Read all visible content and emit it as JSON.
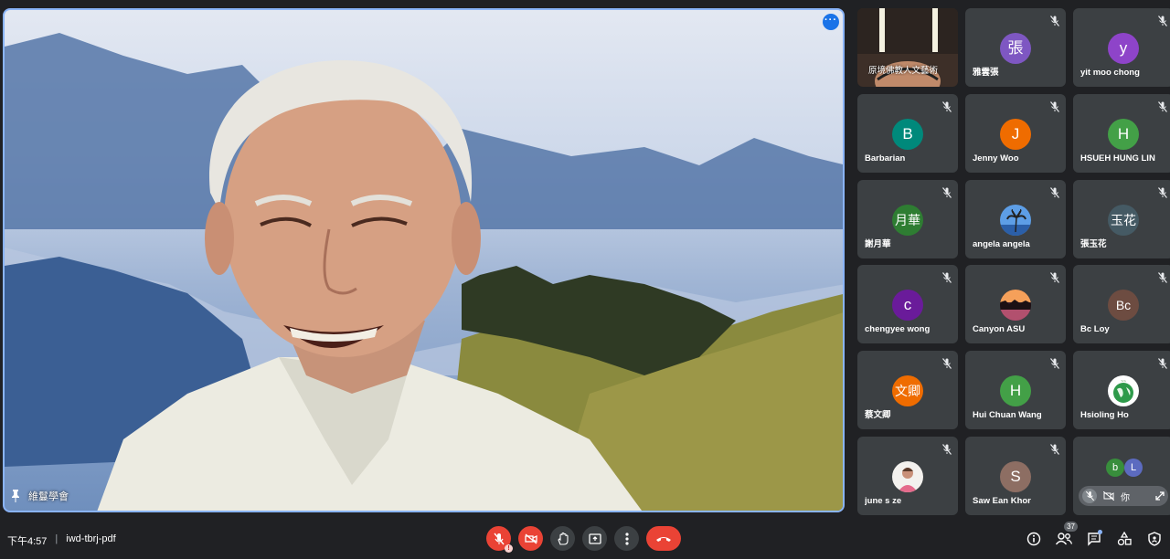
{
  "main": {
    "name": "維鬘學會"
  },
  "participants": [
    {
      "name": "原境佛教人文藝術",
      "initial": "",
      "color": "",
      "type": "video"
    },
    {
      "name": "雅雲張",
      "initial": "張",
      "color": "#7e57c2"
    },
    {
      "name": "yit moo chong",
      "initial": "y",
      "color": "#8e44c9"
    },
    {
      "name": "Barbarian",
      "initial": "B",
      "color": "#00897b"
    },
    {
      "name": "Jenny Woo",
      "initial": "J",
      "color": "#ef6c00"
    },
    {
      "name": "HSUEH HUNG LIN",
      "initial": "H",
      "color": "#43a047"
    },
    {
      "name": "謝月華",
      "initial": "月華",
      "color": "#2e7d32"
    },
    {
      "name": "angela angela",
      "initial": "",
      "color": "#1e88e5",
      "type": "photo-palm"
    },
    {
      "name": "張玉花",
      "initial": "玉花",
      "color": "#455a64"
    },
    {
      "name": "chengyee wong",
      "initial": "c",
      "color": "#6a1b9a"
    },
    {
      "name": "Canyon ASU",
      "initial": "",
      "color": "#4a2c38",
      "type": "photo-canyon"
    },
    {
      "name": "Bc Loy",
      "initial": "Bc",
      "color": "#6d4c41"
    },
    {
      "name": "蔡文卿",
      "initial": "文卿",
      "color": "#ef6c00"
    },
    {
      "name": "Hui Chuan Wang",
      "initial": "H",
      "color": "#43a047"
    },
    {
      "name": "Hsioling Ho",
      "initial": "",
      "color": "#2e7d32",
      "type": "photo-earth"
    },
    {
      "name": "june s ze",
      "initial": "",
      "color": "#f8bbd0",
      "type": "photo-person"
    },
    {
      "name": "Saw Ean Khor",
      "initial": "S",
      "color": "#8d6e63"
    }
  ],
  "more_tile": {
    "avatar1": "b",
    "avatar2": "L",
    "avatar1_color": "#388e3c",
    "avatar2_color": "#5c6bc0",
    "label": "你"
  },
  "bottom": {
    "time": "下午4:57",
    "separator": "|",
    "meeting_code": "iwd-tbrj-pdf",
    "participant_count": "37"
  }
}
